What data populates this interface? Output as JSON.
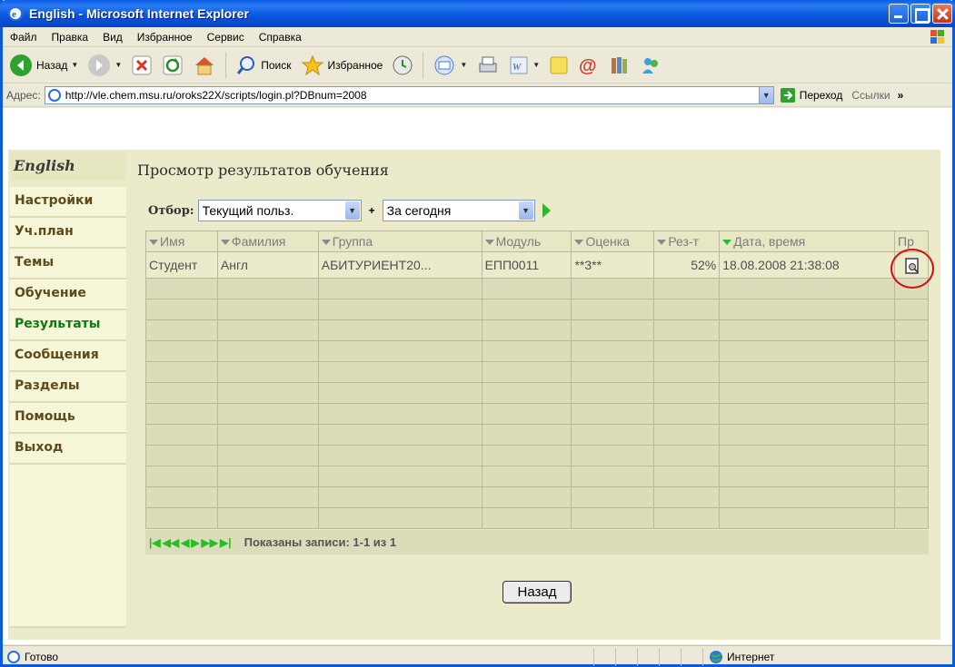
{
  "window": {
    "title": "English - Microsoft Internet Explorer"
  },
  "menu": [
    "Файл",
    "Правка",
    "Вид",
    "Избранное",
    "Сервис",
    "Справка"
  ],
  "toolbar": {
    "back_label": "Назад",
    "search_label": "Поиск",
    "favorites_label": "Избранное"
  },
  "address": {
    "label": "Адрес:",
    "url": "http://vle.chem.msu.ru/oroks22X/scripts/login.pl?DBnum=2008",
    "go_label": "Переход",
    "links_label": "Ссылки"
  },
  "sidebar": {
    "header": "English",
    "items": [
      {
        "label": "Настройки"
      },
      {
        "label": "Уч.план"
      },
      {
        "label": "Темы"
      },
      {
        "label": "Обучение"
      },
      {
        "label": "Результаты"
      },
      {
        "label": "Сообщения"
      },
      {
        "label": "Разделы"
      },
      {
        "label": "Помощь"
      },
      {
        "label": "Выход"
      }
    ]
  },
  "main": {
    "title": "Просмотр результатов обучения",
    "filter": {
      "label": "Отбор:",
      "user_value": "Текущий польз.",
      "plus": "+",
      "period_value": "За сегодня"
    },
    "columns": [
      "Имя",
      "Фамилия",
      "Группа",
      "Модуль",
      "Оценка",
      "Рез-т",
      "Дата, время",
      "Пр"
    ],
    "rows": [
      {
        "first_name": "Студент",
        "last_name": "Англ",
        "group": "АБИТУРИЕНТ20...",
        "module": "ЕПП0011",
        "grade": "**3**",
        "result": "52%",
        "datetime": "18.08.2008 21:38:08"
      }
    ],
    "pager": {
      "records": "Показаны записи: 1-1 из 1"
    },
    "back_button": "Назад"
  },
  "status": {
    "text": "Готово",
    "zone": "Интернет"
  }
}
